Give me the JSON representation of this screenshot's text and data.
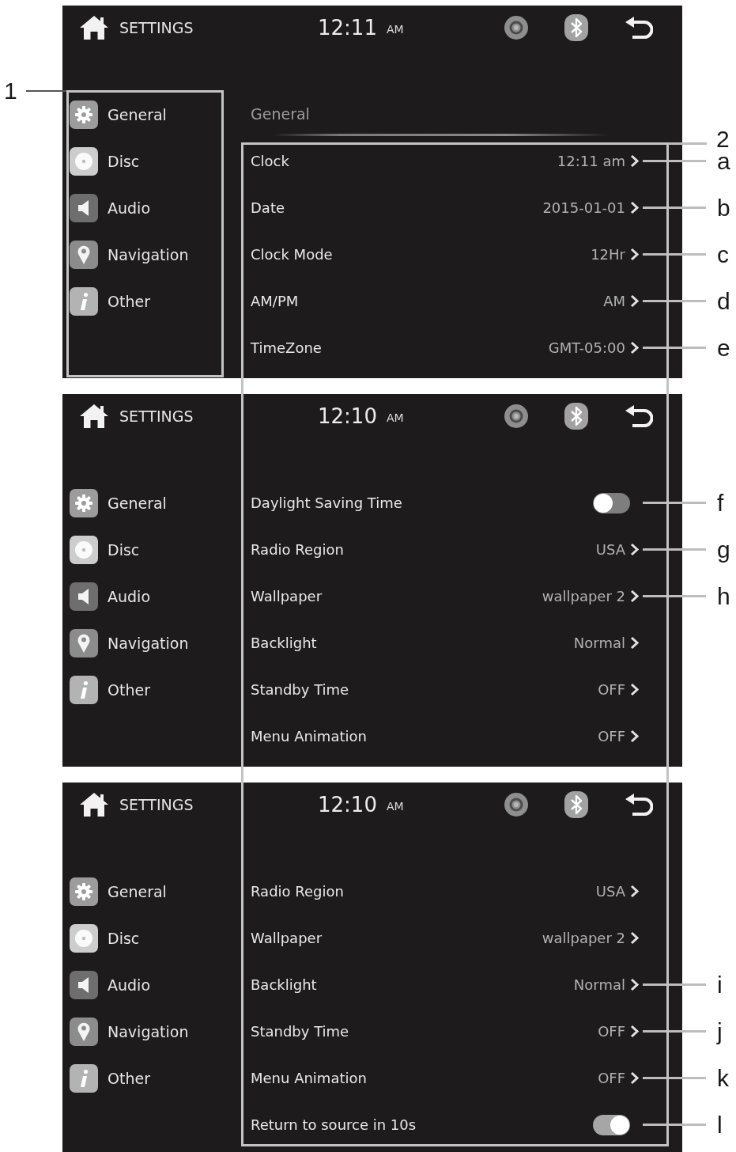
{
  "annotations": {
    "sidebar_callout": "1",
    "list_callout": "2"
  },
  "screens": [
    {
      "header": {
        "title": "SETTINGS",
        "time": "12:11",
        "meridiem": "AM"
      },
      "sidebar": {
        "items": [
          {
            "label": "General",
            "kind": "general"
          },
          {
            "label": "Disc",
            "kind": "disc"
          },
          {
            "label": "Audio",
            "kind": "audio"
          },
          {
            "label": "Navigation",
            "kind": "navigation"
          },
          {
            "label": "Other",
            "kind": "other"
          }
        ]
      },
      "section_title": "General",
      "settings": [
        {
          "label": "Clock",
          "kind": "link",
          "value": "12:11 am",
          "callout": "a"
        },
        {
          "label": "Date",
          "kind": "link",
          "value": "2015-01-01",
          "callout": "b"
        },
        {
          "label": "Clock Mode",
          "kind": "link",
          "value": "12Hr",
          "callout": "c"
        },
        {
          "label": "AM/PM",
          "kind": "link",
          "value": "AM",
          "callout": "d"
        },
        {
          "label": "TimeZone",
          "kind": "link",
          "value": "GMT-05:00",
          "callout": "e"
        }
      ]
    },
    {
      "header": {
        "title": "SETTINGS",
        "time": "12:10",
        "meridiem": "AM"
      },
      "sidebar": {
        "items": [
          {
            "label": "General",
            "kind": "general"
          },
          {
            "label": "Disc",
            "kind": "disc"
          },
          {
            "label": "Audio",
            "kind": "audio"
          },
          {
            "label": "Navigation",
            "kind": "navigation"
          },
          {
            "label": "Other",
            "kind": "other"
          }
        ]
      },
      "settings": [
        {
          "label": "Daylight Saving Time",
          "kind": "toggle",
          "on": false,
          "callout": "f"
        },
        {
          "label": "Radio Region",
          "kind": "link",
          "value": "USA",
          "callout": "g"
        },
        {
          "label": "Wallpaper",
          "kind": "link",
          "value": "wallpaper 2",
          "callout": "h"
        },
        {
          "label": "Backlight",
          "kind": "link",
          "value": "Normal"
        },
        {
          "label": "Standby Time",
          "kind": "link",
          "value": "OFF"
        },
        {
          "label": "Menu Animation",
          "kind": "link",
          "value": "OFF"
        }
      ]
    },
    {
      "header": {
        "title": "SETTINGS",
        "time": "12:10",
        "meridiem": "AM"
      },
      "sidebar": {
        "items": [
          {
            "label": "General",
            "kind": "general"
          },
          {
            "label": "Disc",
            "kind": "disc"
          },
          {
            "label": "Audio",
            "kind": "audio"
          },
          {
            "label": "Navigation",
            "kind": "navigation"
          },
          {
            "label": "Other",
            "kind": "other"
          }
        ]
      },
      "settings": [
        {
          "label": "Radio Region",
          "kind": "link",
          "value": "USA"
        },
        {
          "label": "Wallpaper",
          "kind": "link",
          "value": "wallpaper 2"
        },
        {
          "label": "Backlight",
          "kind": "link",
          "value": "Normal",
          "callout": "i"
        },
        {
          "label": "Standby Time",
          "kind": "link",
          "value": "OFF",
          "callout": "j"
        },
        {
          "label": "Menu Animation",
          "kind": "link",
          "value": "OFF",
          "callout": "k"
        },
        {
          "label": "Return to source in 10s",
          "kind": "toggle",
          "on": true,
          "callout": "l"
        }
      ]
    }
  ]
}
